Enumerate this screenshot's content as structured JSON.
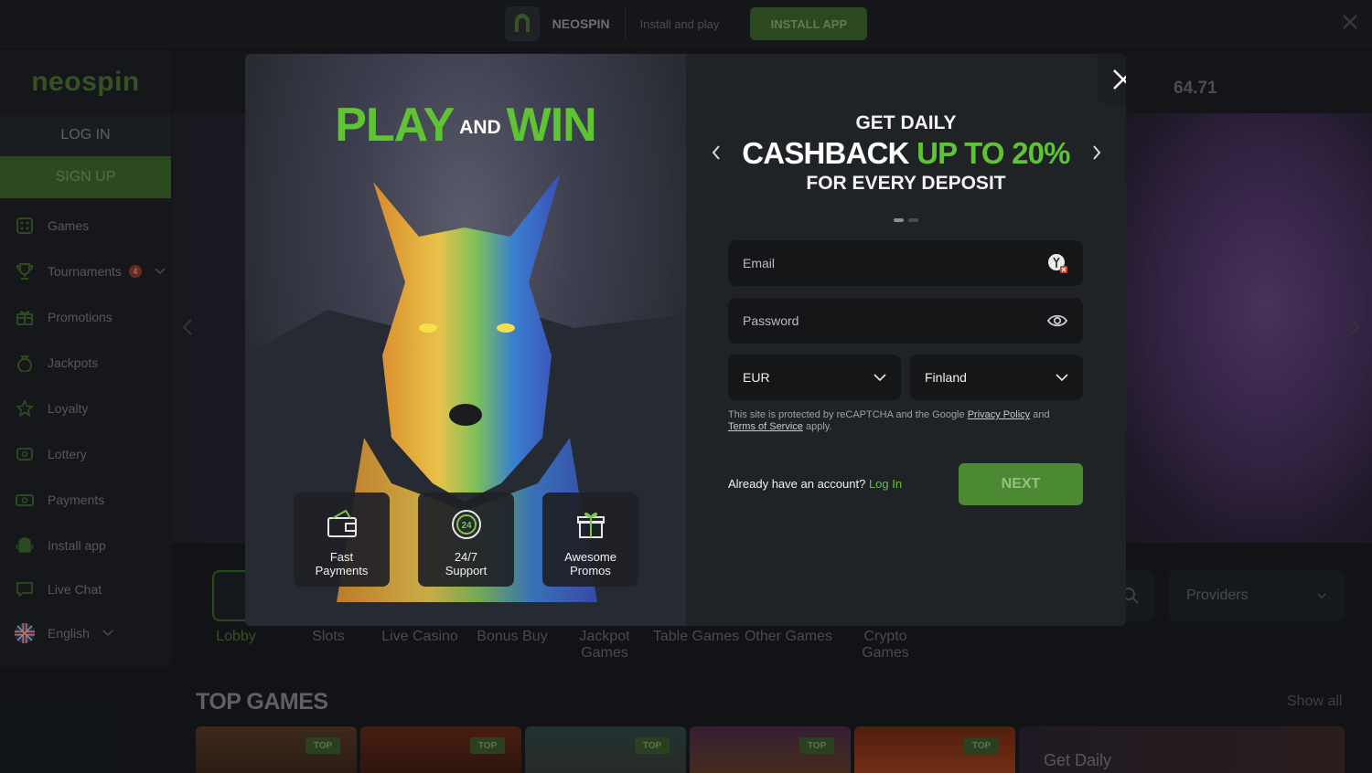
{
  "install_bar": {
    "app_name": "NEOSPIN",
    "tagline": "Install and play",
    "install_label": "INSTALL APP"
  },
  "sidebar": {
    "logo": "neospin",
    "login_label": "LOG IN",
    "signup_label": "SIGN UP",
    "items": [
      {
        "label": "Games",
        "icon": "dice-icon"
      },
      {
        "label": "Tournaments",
        "icon": "trophy-icon",
        "badge": "4"
      },
      {
        "label": "Promotions",
        "icon": "gift-icon"
      },
      {
        "label": "Jackpots",
        "icon": "money-bag-icon"
      },
      {
        "label": "Loyalty",
        "icon": "star-icon"
      },
      {
        "label": "Lottery",
        "icon": "ticket-icon"
      },
      {
        "label": "Payments",
        "icon": "cash-icon"
      },
      {
        "label": "Install app",
        "icon": "android-icon"
      },
      {
        "label": "Live Chat",
        "icon": "chat-icon"
      },
      {
        "label": "English",
        "icon": "uk-flag-icon"
      }
    ]
  },
  "header": {
    "jackpot_value": "64.71"
  },
  "categories": [
    {
      "label": "Lobby",
      "active": true
    },
    {
      "label": "Slots"
    },
    {
      "label": "Live Casino"
    },
    {
      "label": "Bonus Buy"
    },
    {
      "label": "Jackpot Games"
    },
    {
      "label": "Table Games"
    },
    {
      "label": "Other Games"
    },
    {
      "label": "Crypto Games"
    }
  ],
  "providers_label": "Providers",
  "top_games": {
    "title": "TOP GAMES",
    "show_all": "Show all",
    "tag": "TOP",
    "promo_card": "Get Daily"
  },
  "modal": {
    "headline_play": "PLAY",
    "headline_and": "AND",
    "headline_win": "WIN",
    "features": [
      {
        "label": "Fast\nPayments",
        "icon": "wallet-icon"
      },
      {
        "label": "24/7\nSupport",
        "icon": "support-24-icon"
      },
      {
        "label": "Awesome\nPromos",
        "icon": "gift-box-icon"
      }
    ],
    "promo_line1": "GET DAILY",
    "promo_line2_a": "CASHBACK",
    "promo_line2_b": "UP TO 20%",
    "promo_line3": "FOR EVERY DEPOSIT",
    "email_placeholder": "Email",
    "password_placeholder": "Password",
    "currency": "EUR",
    "country": "Finland",
    "captcha_pre": "This site is protected by reCAPTCHA and the Google",
    "privacy_link": "Privacy Policy",
    "captcha_and": "and",
    "terms_link": "Terms of Service",
    "captcha_post": "apply.",
    "already_text": "Already have an account?",
    "login_link": "Log In",
    "next_label": "NEXT"
  },
  "colors": {
    "accent_green": "#5ec434",
    "button_green": "#4b8a33",
    "modal_bg": "#202326",
    "page_bg": "#16191d"
  }
}
